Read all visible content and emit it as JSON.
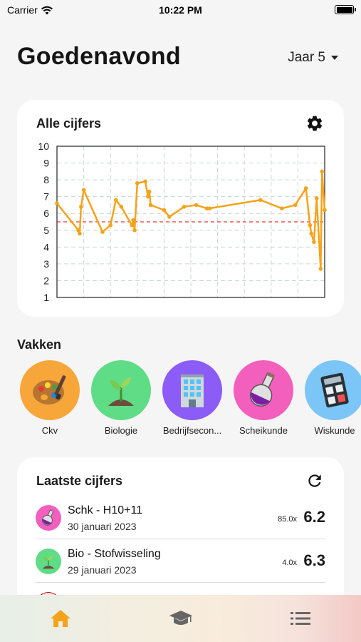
{
  "status_bar": {
    "carrier": "Carrier",
    "time": "10:22 PM"
  },
  "header": {
    "greeting": "Goedenavond",
    "year_label": "Jaar 5"
  },
  "chart_card": {
    "title": "Alle cijfers"
  },
  "chart_data": {
    "type": "line",
    "title": "Alle cijfers",
    "xlabel": "",
    "ylabel": "",
    "ylim": [
      1,
      10
    ],
    "yticks": [
      "1",
      "2",
      "3",
      "4",
      "5",
      "6",
      "7",
      "8",
      "9",
      "10"
    ],
    "pass_threshold": 5.5,
    "grid": true,
    "series": [
      {
        "color": "#f5a31a",
        "values": [
          6.6,
          5.0,
          4.8,
          6.4,
          7.4,
          4.9,
          5.3,
          6.8,
          6.4,
          5.3,
          5.6,
          5.0,
          7.8,
          7.9,
          7.0,
          7.3,
          6.5,
          6.2,
          5.8,
          6.4,
          6.5,
          6.3,
          6.3,
          6.8,
          6.3,
          6.5,
          7.5,
          5.3,
          4.8,
          4.3,
          6.9,
          2.7,
          8.5,
          6.2
        ]
      }
    ]
  },
  "subjects_section": {
    "title": "Vakken",
    "items": [
      {
        "name": "Ckv",
        "color": "#f7a63a",
        "icon": "palette-icon"
      },
      {
        "name": "Biologie",
        "color": "#5fdc86",
        "icon": "seedling-icon"
      },
      {
        "name": "Bedrijfsecon...",
        "color": "#8b5cf6",
        "icon": "office-building-icon"
      },
      {
        "name": "Scheikunde",
        "color": "#f35fbd",
        "icon": "flask-icon"
      },
      {
        "name": "Wiskunde",
        "color": "#7cc6f7",
        "icon": "calculator-icon"
      }
    ]
  },
  "latest_grades": {
    "title": "Laatste cijfers",
    "items": [
      {
        "title": "Schk - H10+11",
        "date": "30 januari 2023",
        "weight": "85.0x",
        "grade": "6.2",
        "color": "#f35fbd",
        "icon": "flask-icon"
      },
      {
        "title": "Bio - Stofwisseling",
        "date": "29 januari 2023",
        "weight": "4.0x",
        "grade": "6.3",
        "color": "#5fdc86",
        "icon": "seedling-icon"
      }
    ]
  },
  "tabbar": {
    "active_color": "#f5a31a",
    "inactive_color": "#666666",
    "tabs": [
      {
        "icon": "home-icon",
        "active": true
      },
      {
        "icon": "graduation-cap-icon",
        "active": false
      },
      {
        "icon": "list-icon",
        "active": false
      }
    ]
  }
}
